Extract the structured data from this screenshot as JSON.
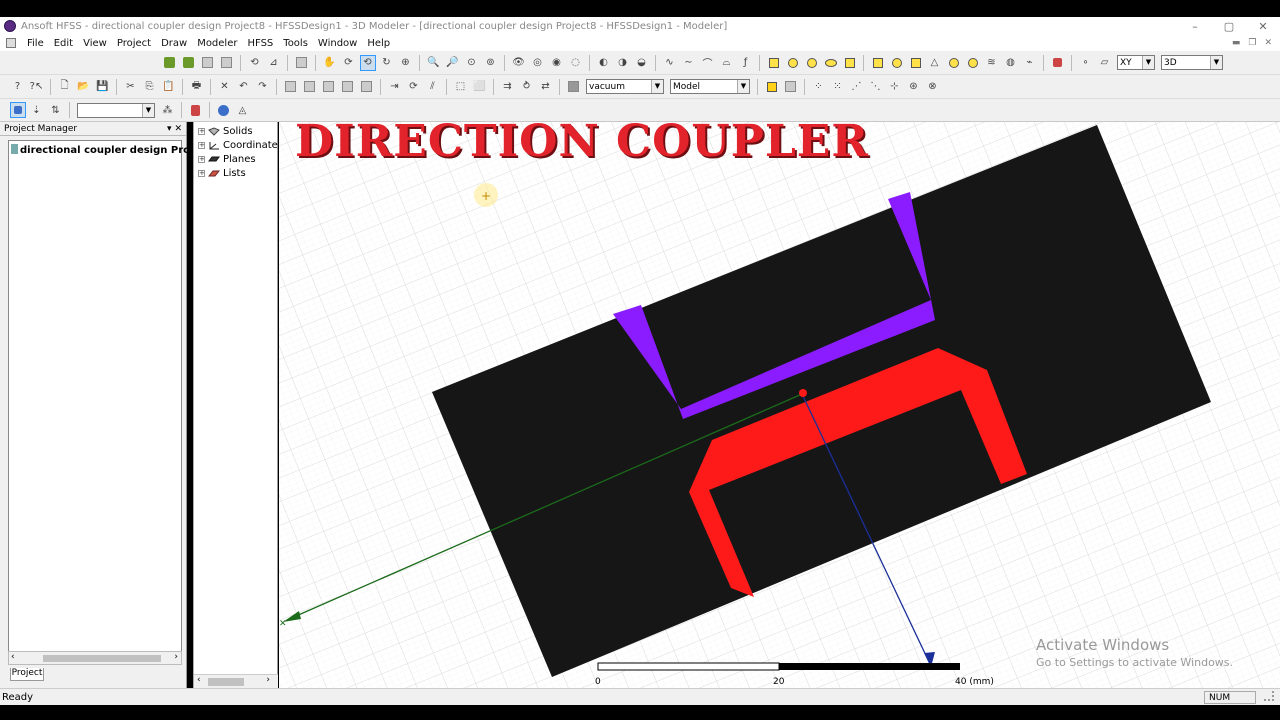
{
  "app": {
    "window_title": "Ansoft HFSS - directional coupler design Project8 - HFSSDesign1 - 3D Modeler - [directional coupler design Project8 - HFSSDesign1 - Modeler]",
    "window_buttons": [
      "–",
      "▢",
      "✕"
    ]
  },
  "menu": [
    "File",
    "Edit",
    "View",
    "Project",
    "Draw",
    "Modeler",
    "HFSS",
    "Tools",
    "Window",
    "Help"
  ],
  "toolbar": {
    "material_value": "vacuum",
    "mode_value": "Model",
    "plane_value": "XY",
    "dimension_value": "3D",
    "selection_value": ""
  },
  "project_manager": {
    "header": "Project Manager",
    "project_name": "directional coupler design Project8",
    "tab_label": "Project"
  },
  "model_tree": {
    "items": [
      "Solids",
      "Coordinate",
      "Planes",
      "Lists"
    ]
  },
  "viewport": {
    "overlay_title": "DIRECTION COUPLER",
    "scale_labels": [
      "0",
      "20",
      "40 (mm)"
    ],
    "watermark_line1": "Activate Windows",
    "watermark_line2": "Go to Settings to activate Windows.",
    "colors": {
      "substrate": "#161616",
      "coupled_line": "#8b1cff",
      "main_line": "#ff1a1a",
      "x_axis": "#1b6b1b",
      "y_axis": "#1a2f9a",
      "overlay": "#e3232b"
    }
  },
  "status": {
    "left": "Ready",
    "num": "NUM"
  }
}
